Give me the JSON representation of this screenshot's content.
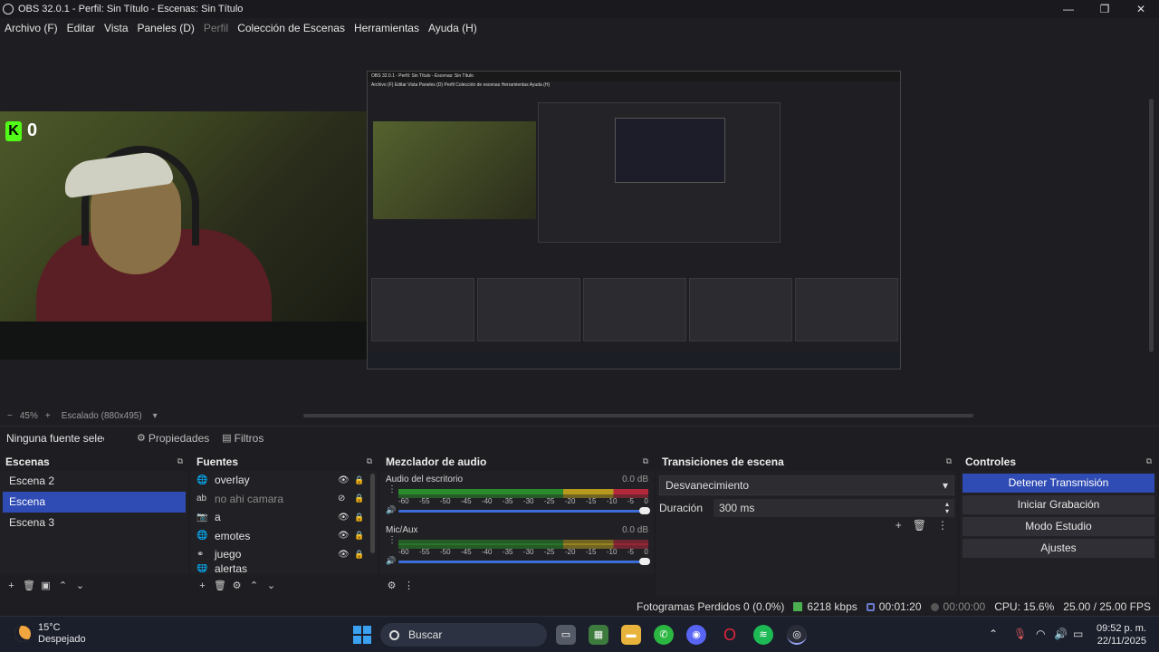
{
  "window": {
    "title": "OBS 32.0.1 - Perfil: Sin Título - Escenas: Sin Título",
    "minimize": "—",
    "maximize": "❐",
    "close": "✕"
  },
  "menu": {
    "items": [
      "Archivo (F)",
      "Editar",
      "Vista",
      "Paneles (D)",
      "Perfil",
      "Colección de Escenas",
      "Herramientas",
      "Ayuda (H)"
    ]
  },
  "preview": {
    "kick_count": "0",
    "nested_title": "OBS 32.0.1 - Perfil: Sin Título - Escenas: Sin Título",
    "nested_menu": "Archivo (F)   Editar   Vista   Paneles (D)   Perfil   Colección de escenas   Herramientas   Ayuda (H)"
  },
  "zoom": {
    "minus": "−",
    "percent": "45%",
    "plus": "+",
    "scaling": "Escalado (880x495)"
  },
  "source_toolbar": {
    "no_source": "Ninguna fuente selec",
    "properties": "Propiedades",
    "filters": "Filtros"
  },
  "scenes": {
    "title": "Escenas",
    "items": [
      "Escena 2",
      "Escena",
      "Escena 3"
    ],
    "selected_index": 1
  },
  "sources": {
    "title": "Fuentes",
    "items": [
      {
        "name": "overlay",
        "icon": "globe-icon",
        "visible": true
      },
      {
        "name": "no ahi camara",
        "icon": "text-icon",
        "visible": false
      },
      {
        "name": "a",
        "icon": "camera-icon",
        "visible": true
      },
      {
        "name": "emotes",
        "icon": "globe-icon",
        "visible": true
      },
      {
        "name": "juego",
        "icon": "link-icon",
        "visible": true
      },
      {
        "name": "alertas",
        "icon": "globe-icon",
        "visible": true
      }
    ]
  },
  "mixer": {
    "title": "Mezclador de audio",
    "channels": [
      {
        "name": "Audio del escritorio",
        "db": "0.0 dB"
      },
      {
        "name": "Mic/Aux",
        "db": "0.0 dB"
      }
    ],
    "scale": [
      "-60",
      "-55",
      "-50",
      "-45",
      "-40",
      "-35",
      "-30",
      "-25",
      "-20",
      "-15",
      "-10",
      "-5",
      "0"
    ]
  },
  "transitions": {
    "title": "Transiciones de escena",
    "selected": "Desvanecimiento",
    "duration_label": "Duración",
    "duration_value": "300 ms"
  },
  "controls": {
    "title": "Controles",
    "buttons": [
      "Detener Transmisión",
      "Iniciar Grabación",
      "Modo Estudio",
      "Ajustes"
    ]
  },
  "status": {
    "dropped": "Fotogramas Perdidos 0 (0.0%)",
    "bitrate": "6218 kbps",
    "stream_time": "00:01:20",
    "rec_time": "00:00:00",
    "cpu": "CPU: 15.6%",
    "fps": "25.00 / 25.00 FPS"
  },
  "taskbar": {
    "temp": "15°C",
    "weather": "Despejado",
    "search": "Buscar",
    "time": "09:52 p. m.",
    "date": "22/11/2025"
  }
}
